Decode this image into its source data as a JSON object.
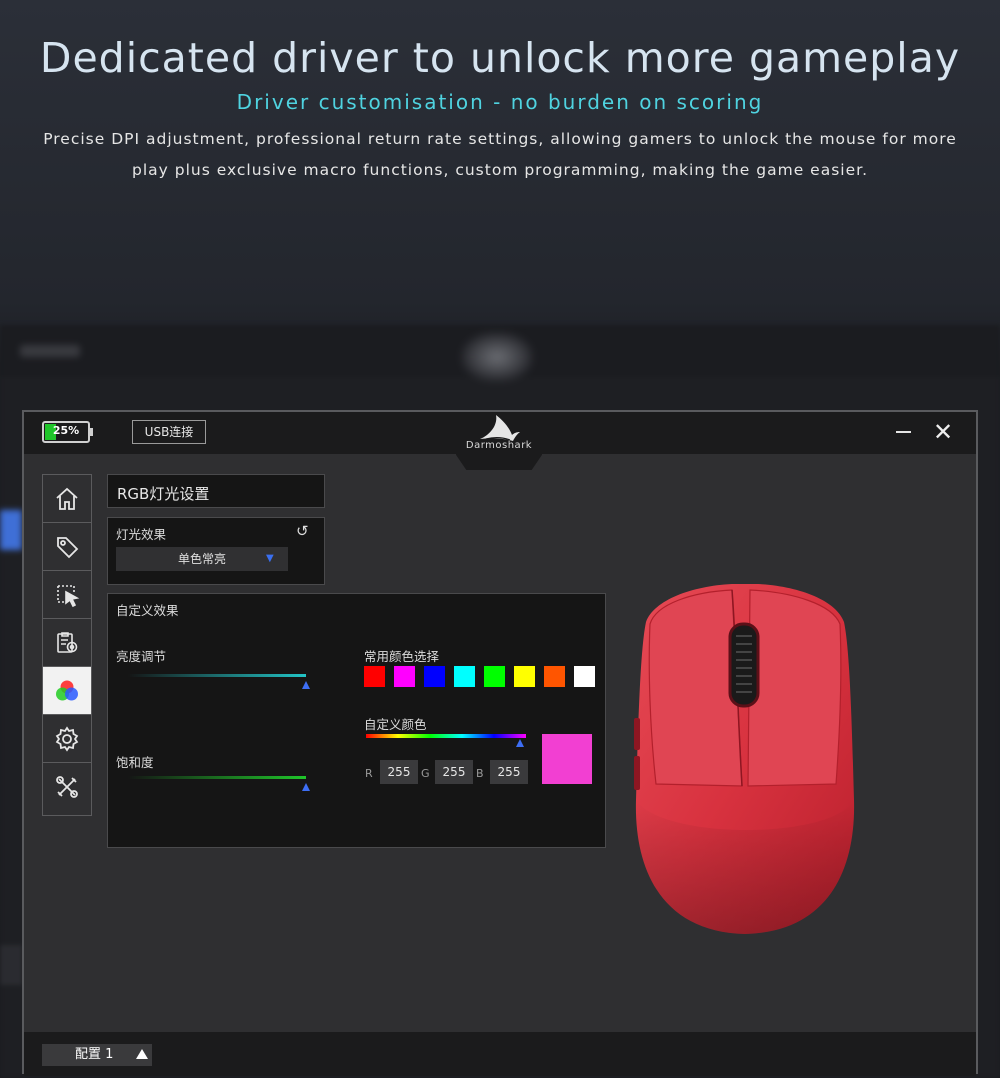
{
  "hero": {
    "title": "Dedicated driver to unlock more gameplay",
    "subtitle": "Driver customisation - no burden on scoring",
    "description": "Precise DPI adjustment, professional return rate settings, allowing gamers to unlock the mouse for more play plus exclusive macro functions, custom programming, making the game easier."
  },
  "titlebar": {
    "battery_label": "25%",
    "battery_level": 0.25,
    "usb_button": "USB连接",
    "brand": "Darmoshark",
    "minimize_icon": "minimize-icon",
    "close_icon": "close-icon"
  },
  "sidebar": {
    "items": [
      {
        "icon": "home-icon",
        "active": false
      },
      {
        "icon": "tag-icon",
        "active": false
      },
      {
        "icon": "cursor-select-icon",
        "active": false
      },
      {
        "icon": "macro-clipboard-icon",
        "active": false
      },
      {
        "icon": "rgb-lighting-icon",
        "active": true
      },
      {
        "icon": "settings-gear-icon",
        "active": false
      },
      {
        "icon": "tools-icon",
        "active": false
      }
    ]
  },
  "rgb_panel": {
    "title": "RGB灯光设置",
    "effect_label": "灯光效果",
    "effect_selected": "单色常亮",
    "reset_icon": "reset-icon",
    "custom_effect_label": "自定义效果",
    "brightness_label": "亮度调节",
    "brightness_value": 1.0,
    "saturation_label": "饱和度",
    "saturation_value": 1.0,
    "common_colors_label": "常用颜色选择",
    "common_colors": [
      "#ff0000",
      "#ff00ff",
      "#0000ff",
      "#00ffff",
      "#00ff00",
      "#ffff00",
      "#ff5500",
      "#ffffff"
    ],
    "custom_color_label": "自定义颜色",
    "hue_position": 0.96,
    "r_label": "R",
    "r_value": "255",
    "g_label": "G",
    "g_value": "255",
    "b_label": "B",
    "b_value": "255",
    "preview_color": "#f23fd2"
  },
  "footer": {
    "profile_label": "配置 1"
  },
  "colors": {
    "accent_blue": "#3d6ef3",
    "brightness_track": "#22c4c6",
    "saturation_track": "#1fc52a",
    "mouse_red": "#d8323f"
  }
}
